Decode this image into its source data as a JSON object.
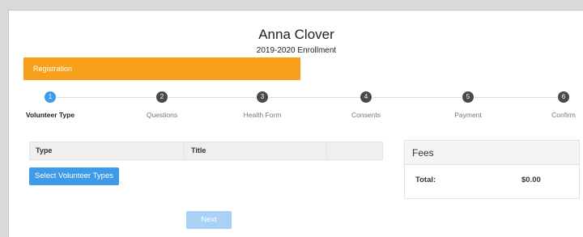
{
  "header": {
    "name": "Anna Clover",
    "subtitle": "2019-2020 Enrollment"
  },
  "registration_bar": {
    "label": "Registration",
    "color": "#f7a11a"
  },
  "steps": [
    {
      "number": "1",
      "label": "Volunteer Type",
      "active": true
    },
    {
      "number": "2",
      "label": "Questions",
      "active": false
    },
    {
      "number": "3",
      "label": "Health Form",
      "active": false
    },
    {
      "number": "4",
      "label": "Consents",
      "active": false
    },
    {
      "number": "5",
      "label": "Payment",
      "active": false
    },
    {
      "number": "6",
      "label": "Confirm",
      "active": false
    }
  ],
  "table": {
    "columns": [
      "Type",
      "Title",
      ""
    ]
  },
  "select_button": {
    "label": "Select Volunteer Types",
    "color": "#3d9be9"
  },
  "fees": {
    "title": "Fees",
    "total_label": "Total:",
    "total_value": "$0.00"
  },
  "next_button": {
    "label": "Next",
    "disabled": true
  }
}
